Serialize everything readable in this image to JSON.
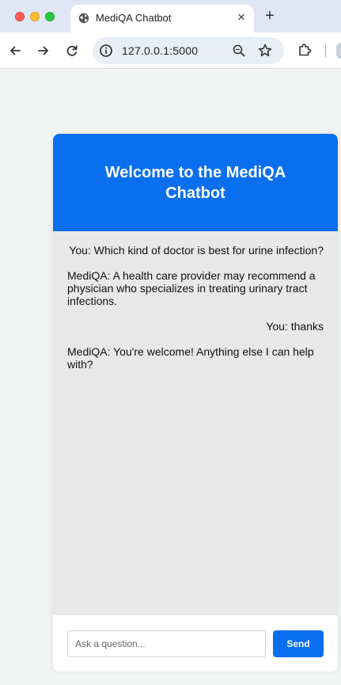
{
  "browser": {
    "tab_title": "MediQA Chatbot",
    "tab_close": "×",
    "new_tab": "+",
    "url": "127.0.0.1:5000"
  },
  "chat": {
    "title": "Welcome to the MediQA Chatbot",
    "messages": [
      {
        "role": "user",
        "text": "You: Which kind of doctor is best for urine infection?"
      },
      {
        "role": "bot",
        "text": "MediQA: A health care provider may recommend a physician who specializes in treating urinary tract infections."
      },
      {
        "role": "user",
        "text": "You: thanks"
      },
      {
        "role": "bot",
        "text": "MediQA: You're welcome! Anything else I can help with?"
      }
    ],
    "input_placeholder": "Ask a question...",
    "send_label": "Send"
  },
  "colors": {
    "accent": "#0a6fef",
    "chat_bg": "#e8e8e8",
    "page_bg": "#f1f4f3"
  },
  "icons": [
    "globe-icon",
    "back-icon",
    "forward-icon",
    "reload-icon",
    "info-icon",
    "zoom-icon",
    "star-icon",
    "extensions-icon"
  ]
}
